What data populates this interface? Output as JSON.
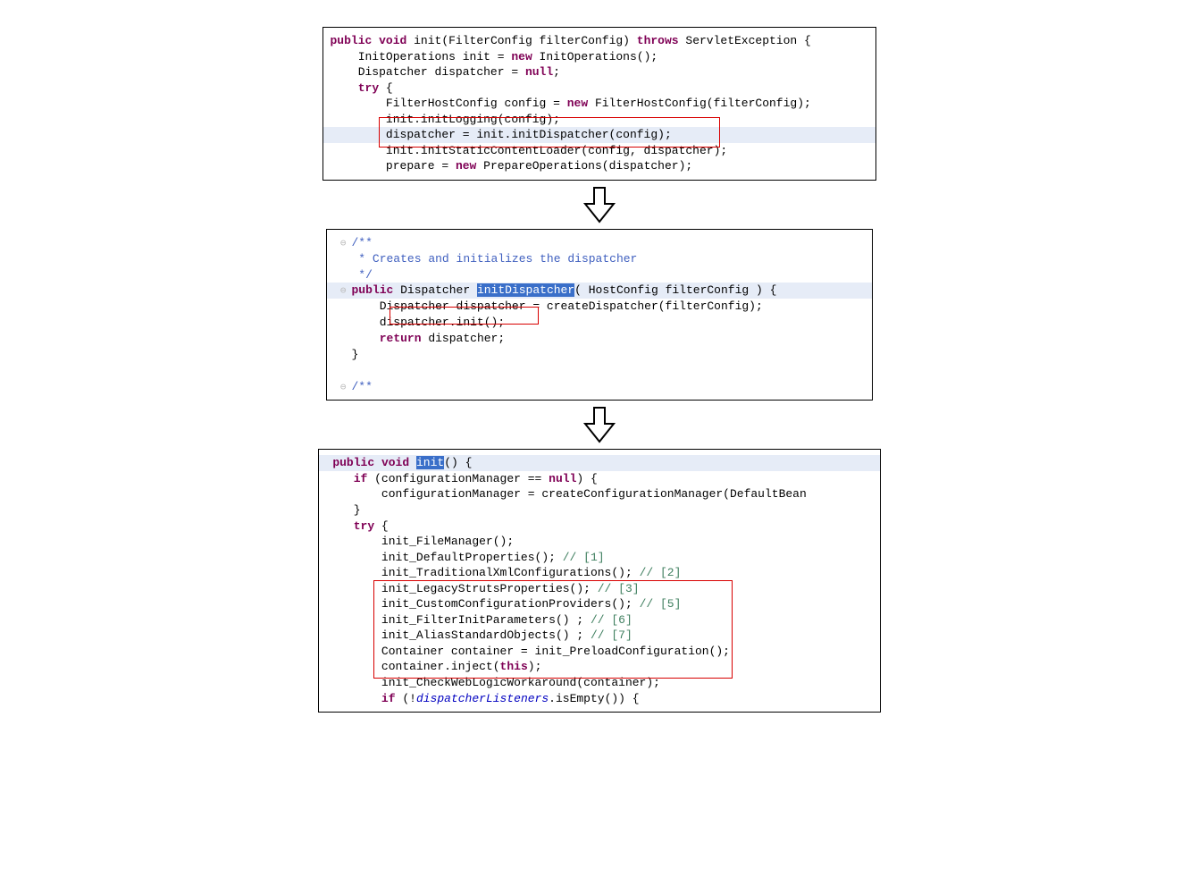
{
  "box1": {
    "l1a": "public",
    "l1b": " void",
    "l1c": " init(FilterConfig filterConfig) ",
    "l1d": "throws",
    "l1e": " ServletException {",
    "l2a": "    InitOperations init = ",
    "l2b": "new",
    "l2c": " InitOperations();",
    "l3a": "    Dispatcher dispatcher = ",
    "l3b": "null",
    "l3c": ";",
    "l4a": "    ",
    "l4b": "try",
    "l4c": " {",
    "l5a": "        FilterHostConfig config = ",
    "l5b": "new",
    "l5c": " FilterHostConfig(filterConfig);",
    "l6": "        init.initLogging(config);",
    "l7": "        dispatcher = init.initDispatcher(config);",
    "l8": "        init.initStaticContentLoader(config, dispatcher);",
    "l9": "",
    "l10a": "        prepare = ",
    "l10b": "new",
    "l10c": " PrepareOperations(dispatcher);"
  },
  "box2": {
    "g1": "⊖",
    "l1": "/**",
    "g2": " ",
    "l2": " * Creates and initializes the dispatcher",
    "g3": " ",
    "l3": " */",
    "g4": "⊖",
    "l4a": "public",
    "l4b": " Dispatcher ",
    "l4sel": "initDispatcher",
    "l4c": "( HostConfig filterConfig ) {",
    "g5": " ",
    "l5": "    Dispatcher dispatcher = createDispatcher(filterConfig);",
    "g6": " ",
    "l6": "    dispatcher.init();",
    "g7": " ",
    "l7a": "    ",
    "l7b": "return",
    "l7c": " dispatcher;",
    "g8": " ",
    "l8": "}",
    "g9": " ",
    "l9": "",
    "g10": "⊖",
    "l10": "/**"
  },
  "box3": {
    "l1a": " ",
    "l1b": "public",
    "l1c": " ",
    "l1d": "void",
    "l1e": " ",
    "l1sel": "init",
    "l1f": "() {",
    "l2": "",
    "l3a": "    ",
    "l3b": "if",
    "l3c": " (configurationManager == ",
    "l3d": "null",
    "l3e": ") {",
    "l4": "        configurationManager = createConfigurationManager(DefaultBean",
    "l5": "    }",
    "l6": "",
    "l7a": "    ",
    "l7b": "try",
    "l7c": " {",
    "l8": "        init_FileManager();",
    "l9a": "        init_DefaultProperties(); ",
    "l9b": "// [1]",
    "l10a": "        init_TraditionalXmlConfigurations(); ",
    "l10b": "// [2]",
    "l11a": "        init_LegacyStrutsProperties(); ",
    "l11b": "// [3]",
    "l12a": "        init_CustomConfigurationProviders(); ",
    "l12b": "// [5]",
    "l13a": "        init_FilterInitParameters() ; ",
    "l13b": "// [6]",
    "l14a": "        init_AliasStandardObjects() ; ",
    "l14b": "// [7]",
    "l15": "",
    "l16": "        Container container = init_PreloadConfiguration();",
    "l17a": "        container.inject(",
    "l17b": "this",
    "l17c": ");",
    "l18": "        init_CheckWebLogicWorkaround(container);",
    "l19": "",
    "l20a": "        ",
    "l20b": "if",
    "l20c": " (!",
    "l20d": "dispatcherListeners",
    "l20e": ".isEmpty()) {"
  }
}
